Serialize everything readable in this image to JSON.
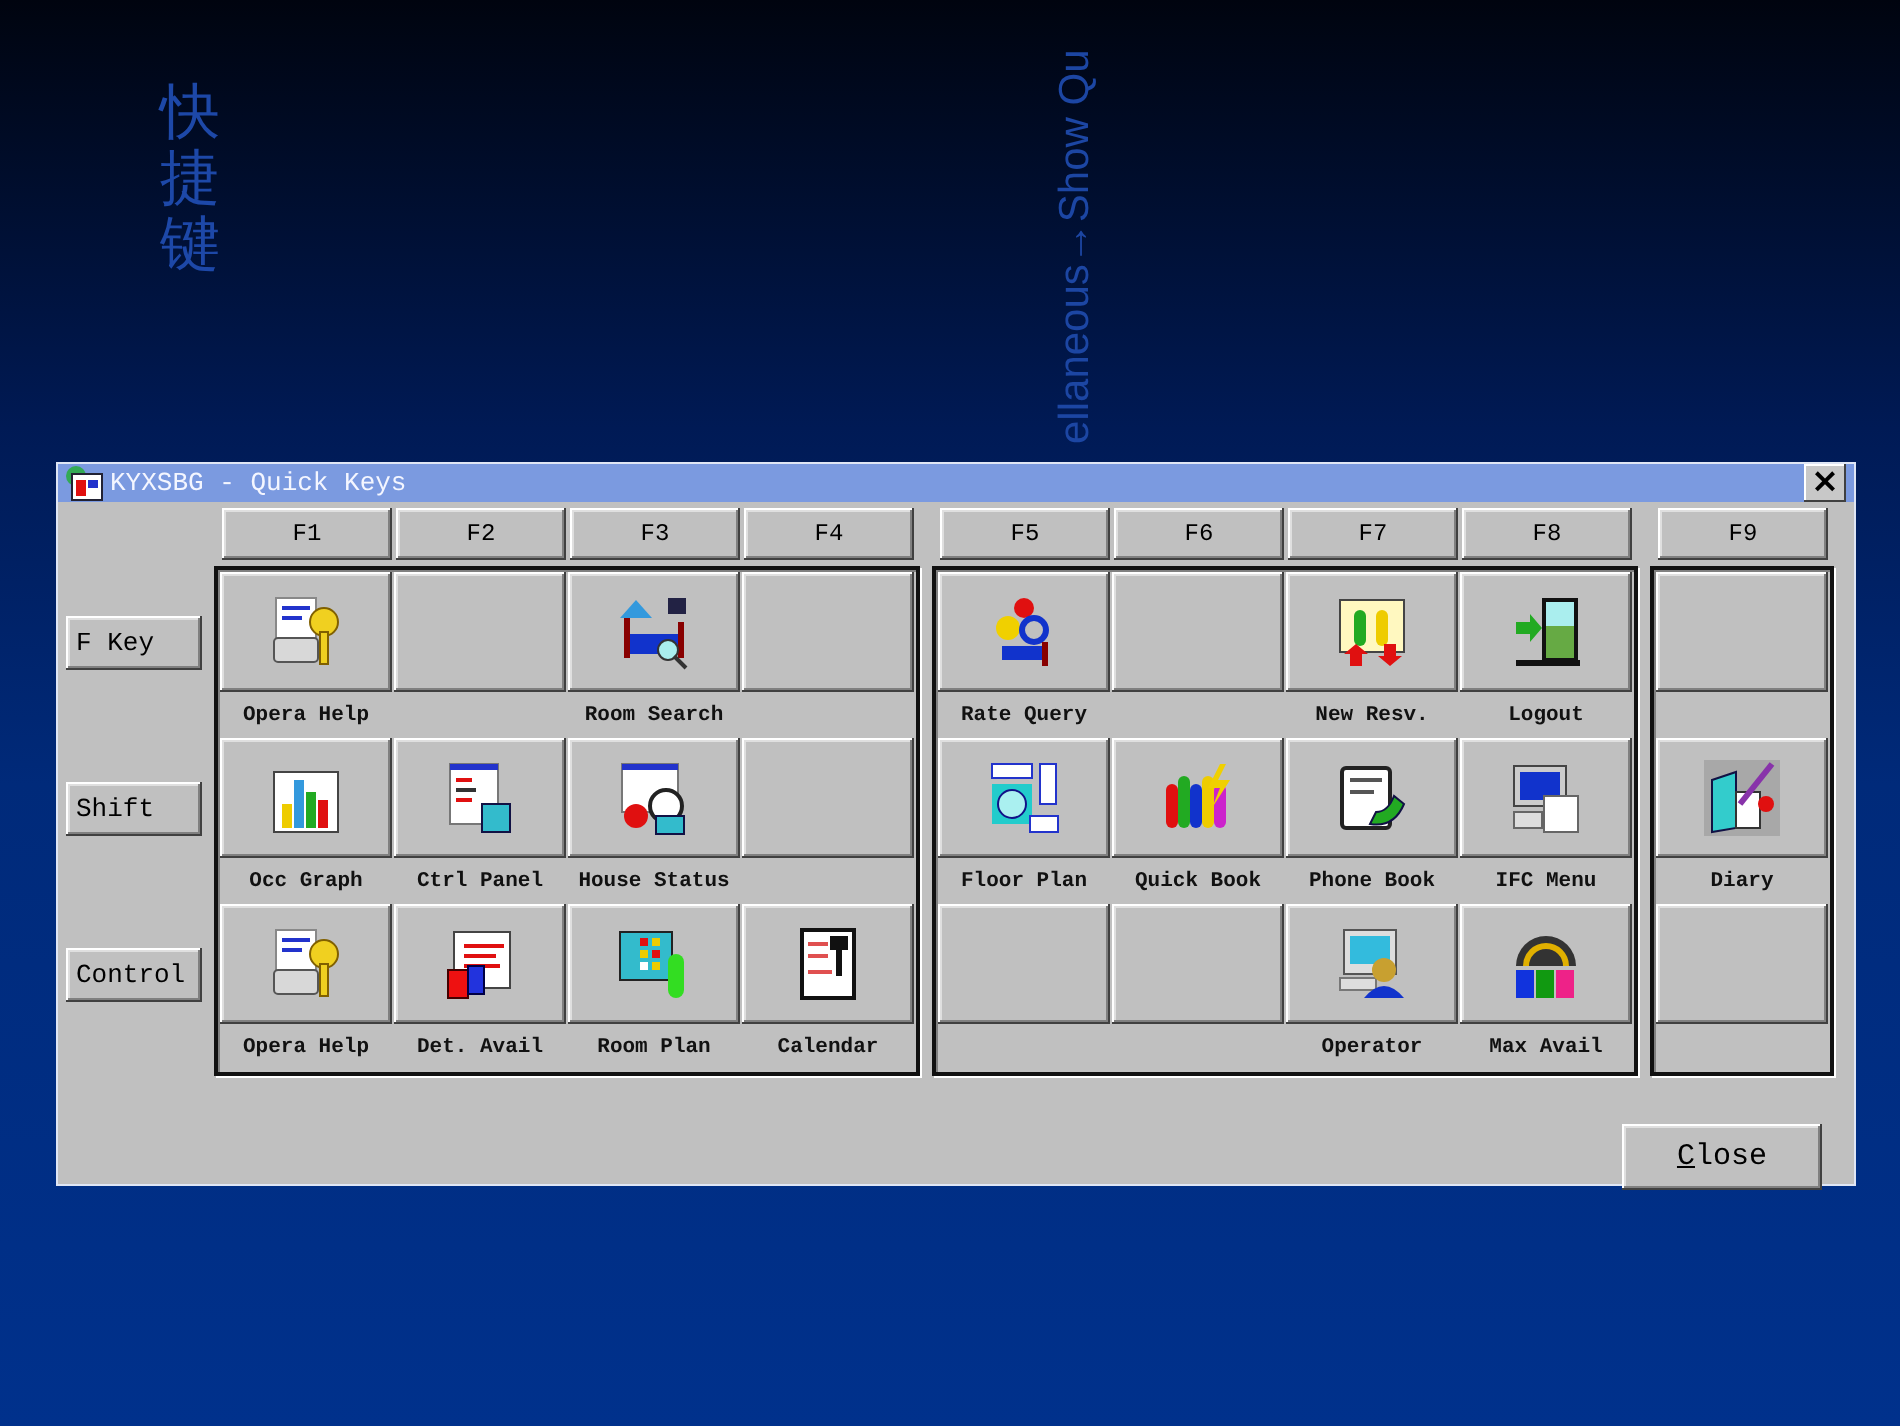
{
  "slide": {
    "title": "快捷键",
    "caption": "ellaneous→Show Qu"
  },
  "window": {
    "title": "KYXSBG - Quick Keys",
    "close": "×"
  },
  "key_groups": [
    [
      "F1",
      "F2",
      "F3",
      "F4"
    ],
    [
      "F5",
      "F6",
      "F7",
      "F8"
    ],
    [
      "F9"
    ]
  ],
  "rows": [
    {
      "modifier": "F Key",
      "cells": [
        {
          "kind": "help",
          "label": "Opera Help"
        },
        {
          "kind": "empty"
        },
        {
          "kind": "room-search",
          "label": "Room Search"
        },
        {
          "kind": "empty"
        },
        {
          "kind": "rate-query",
          "label": "Rate Query"
        },
        {
          "kind": "empty"
        },
        {
          "kind": "new-resv",
          "label": "New Resv."
        },
        {
          "kind": "logout",
          "label": "Logout"
        },
        {
          "kind": "empty"
        }
      ]
    },
    {
      "modifier": "Shift",
      "cells": [
        {
          "kind": "occ-graph",
          "label": "Occ Graph"
        },
        {
          "kind": "ctrl-panel",
          "label": "Ctrl Panel"
        },
        {
          "kind": "house-status",
          "label": "House Status"
        },
        {
          "kind": "empty"
        },
        {
          "kind": "floor-plan",
          "label": "Floor Plan"
        },
        {
          "kind": "quick-book",
          "label": "Quick Book"
        },
        {
          "kind": "phone-book",
          "label": "Phone Book"
        },
        {
          "kind": "ifc-menu",
          "label": "IFC Menu"
        },
        {
          "kind": "diary",
          "label": "Diary"
        }
      ]
    },
    {
      "modifier": "Control",
      "cells": [
        {
          "kind": "help",
          "label": "Opera Help"
        },
        {
          "kind": "det-avail",
          "label": "Det. Avail"
        },
        {
          "kind": "room-plan",
          "label": "Room Plan"
        },
        {
          "kind": "calendar",
          "label": "Calendar"
        },
        {
          "kind": "empty"
        },
        {
          "kind": "empty"
        },
        {
          "kind": "operator",
          "label": "Operator"
        },
        {
          "kind": "max-avail",
          "label": "Max Avail"
        },
        {
          "kind": "empty"
        }
      ]
    }
  ],
  "close_button": "Close"
}
